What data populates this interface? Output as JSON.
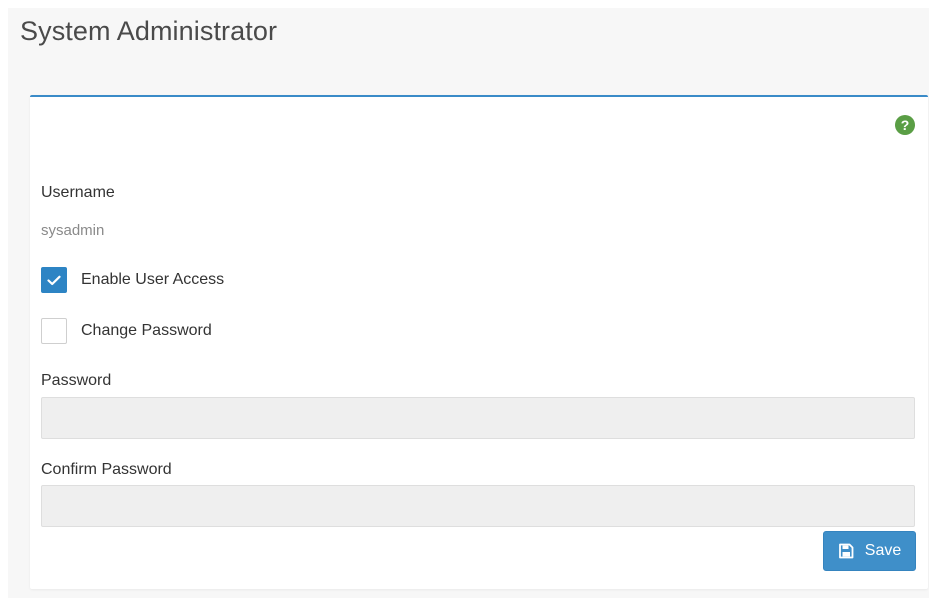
{
  "page": {
    "title": "System Administrator"
  },
  "panel": {
    "accent_color": "#3a8bc8",
    "help_icon": "question-circle-icon",
    "help_glyph": "?",
    "username": {
      "label": "Username",
      "value": "sysadmin"
    },
    "enable_user_access": {
      "label": "Enable User Access",
      "checked": true
    },
    "change_password": {
      "label": "Change Password",
      "checked": false
    },
    "password": {
      "label": "Password",
      "value": "",
      "placeholder": ""
    },
    "confirm_password": {
      "label": "Confirm Password",
      "value": "",
      "placeholder": ""
    },
    "save_button": {
      "label": "Save",
      "icon": "floppy-disk-icon"
    }
  }
}
